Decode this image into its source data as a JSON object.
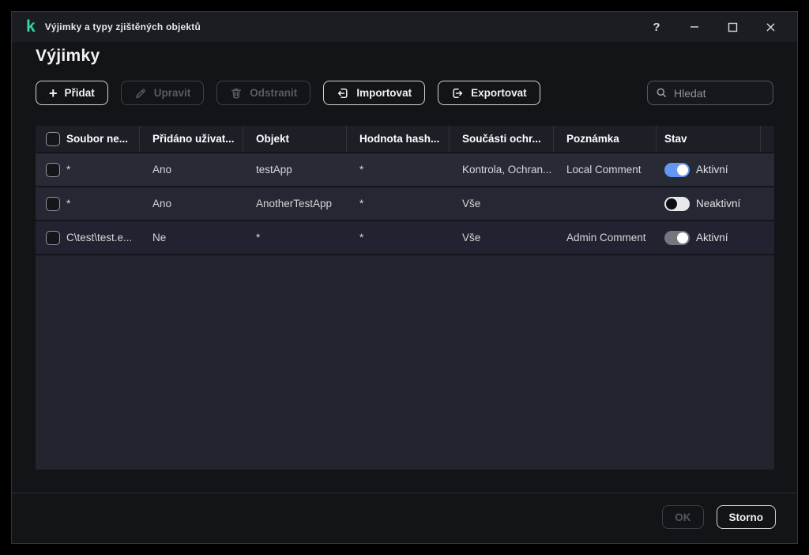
{
  "window": {
    "title": "Výjimky a typy zjištěných objektů",
    "help_glyph": "?"
  },
  "page": {
    "title": "Výjimky"
  },
  "toolbar": {
    "add": {
      "label": "Přidat",
      "state": "enabled",
      "icon": "plus-icon",
      "plus_glyph": "+"
    },
    "edit": {
      "label": "Upravit",
      "state": "disabled",
      "icon": "pencil-icon"
    },
    "delete": {
      "label": "Odstranit",
      "state": "disabled",
      "icon": "trash-icon"
    },
    "import": {
      "label": "Importovat",
      "state": "enabled",
      "icon": "import-icon"
    },
    "export": {
      "label": "Exportovat",
      "state": "enabled",
      "icon": "export-icon"
    },
    "search_placeholder": "Hledat"
  },
  "table": {
    "columns": [
      "Soubor ne...",
      "Přidáno uživat...",
      "Objekt",
      "Hodnota hash...",
      "Součásti ochr...",
      "Poznámka",
      "Stav"
    ],
    "rows": [
      {
        "soubor": "*",
        "pridano": "Ano",
        "objekt": "testApp",
        "hodnota_hash": "*",
        "soucasti": "Kontrola, Ochran...",
        "poznamka": "Local Comment",
        "stav_label": "Aktivní",
        "stav_state": "on"
      },
      {
        "soubor": "*",
        "pridano": "Ano",
        "objekt": "AnotherTestApp",
        "hodnota_hash": "*",
        "soucasti": "Vše",
        "poznamka": "",
        "stav_label": "Neaktivní",
        "stav_state": "off"
      },
      {
        "soubor": "C\\test\\test.e...",
        "pridano": "Ne",
        "objekt": "*",
        "hodnota_hash": "*",
        "soucasti": "Vše",
        "poznamka": "Admin Comment",
        "stav_label": "Aktivní",
        "stav_state": "on-disabled"
      }
    ]
  },
  "footer": {
    "ok": {
      "label": "OK",
      "state": "disabled"
    },
    "cancel": {
      "label": "Storno",
      "state": "enabled"
    }
  },
  "colors": {
    "brand_teal": "#2bd9a9",
    "toggle_on_blue": "#6496f2",
    "toggle_off_track": "#e8e8ea",
    "toggle_disabled_track": "#75777e",
    "window_bg": "#131418",
    "row_bg": "#262833"
  }
}
